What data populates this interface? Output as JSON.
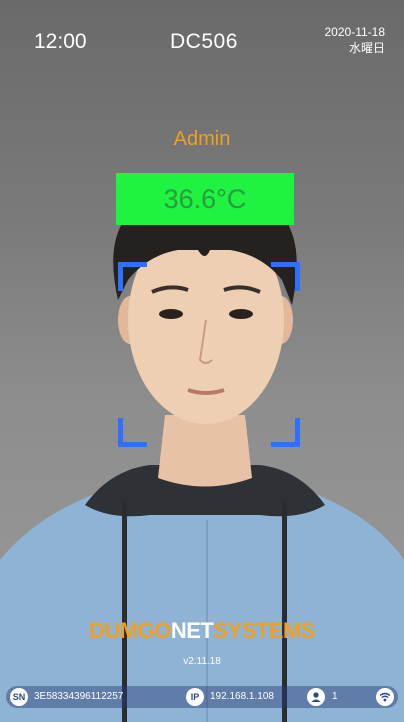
{
  "status": {
    "time": "12:00",
    "device_id": "DC506",
    "date": "2020-11-18",
    "weekday": "水曜日"
  },
  "recognition": {
    "role": "Admin",
    "temperature": "36.6°C",
    "temp_box_color": "#1ff240",
    "frame_color": "#3070ff"
  },
  "brand": {
    "part1": "DUMGO",
    "part2": "NET",
    "part3": "SYSTEMS",
    "accent_color": "#f0a020",
    "version": "v2.11.18"
  },
  "info_bar": {
    "sn_label": "SN",
    "sn_value": "3E58334396112257",
    "ip_label": "IP",
    "ip_value": "192.168.1.108",
    "user_count": "1"
  }
}
